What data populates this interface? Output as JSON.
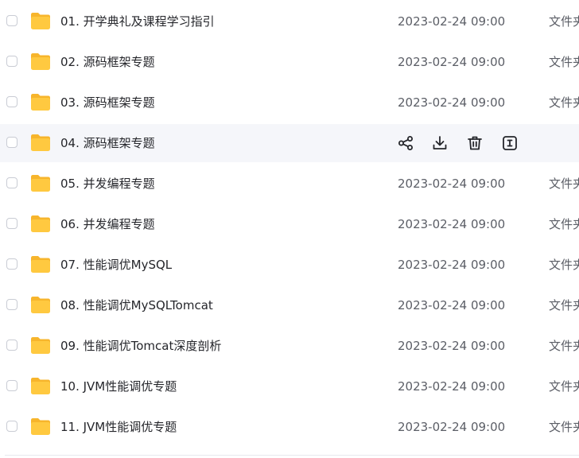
{
  "file_list": {
    "type_label": "文件夹",
    "rows": [
      {
        "name": "01. 开学典礼及课程学习指引",
        "date": "2023-02-24 09:00"
      },
      {
        "name": "02. 源码框架专题",
        "date": "2023-02-24 09:00"
      },
      {
        "name": "03. 源码框架专题",
        "date": "2023-02-24 09:00"
      },
      {
        "name": "04. 源码框架专题",
        "date": "",
        "hovered": true
      },
      {
        "name": "05. 并发编程专题",
        "date": "2023-02-24 09:00"
      },
      {
        "name": "06. 并发编程专题",
        "date": "2023-02-24 09:00"
      },
      {
        "name": "07. 性能调优MySQL",
        "date": "2023-02-24 09:00"
      },
      {
        "name": "08. 性能调优MySQLTomcat",
        "date": "2023-02-24 09:00"
      },
      {
        "name": "09. 性能调优Tomcat深度剖析",
        "date": "2023-02-24 09:00"
      },
      {
        "name": "10. JVM性能调优专题",
        "date": "2023-02-24 09:00"
      },
      {
        "name": "11. JVM性能调优专题",
        "date": "2023-02-24 09:00"
      }
    ],
    "hover_actions": [
      "share-icon",
      "download-icon",
      "delete-icon",
      "rename-icon"
    ]
  },
  "colors": {
    "folder_body": "#ffc940",
    "folder_tab": "#f7b52c",
    "hover_row_bg": "#f5f6fa",
    "icon_stroke": "#25262b"
  }
}
